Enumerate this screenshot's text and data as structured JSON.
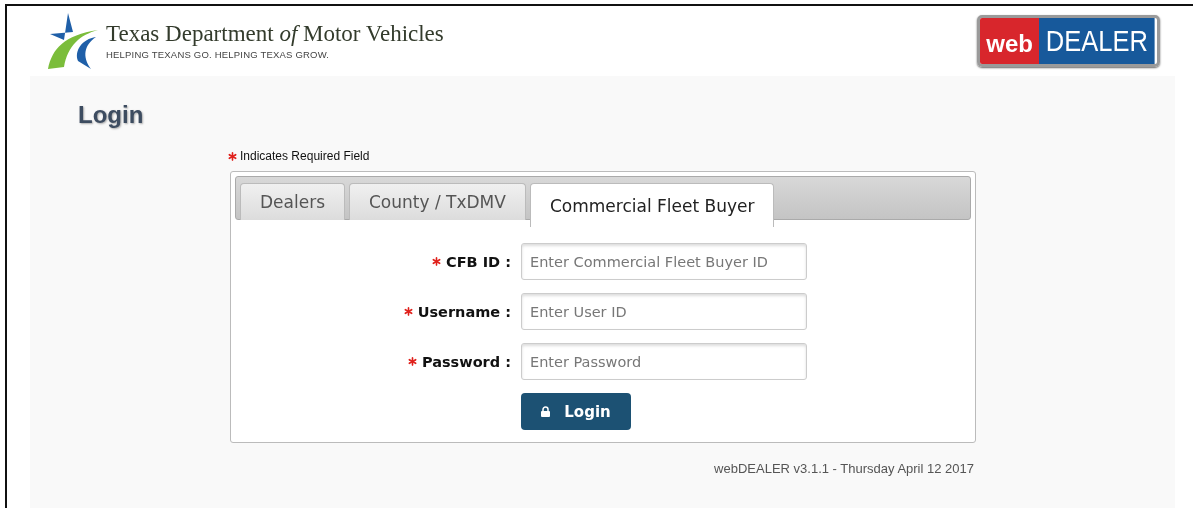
{
  "header": {
    "agency": "Texas Department *of* Motor Vehicles",
    "tagline": "HELPING TEXANS GO. HELPING TEXAS GROW.",
    "product_logo": {
      "part_1": "web",
      "part_2": "DEALER"
    }
  },
  "page_title": "Login",
  "required_note": "Indicates Required Field",
  "tabs": [
    {
      "label": "Dealers",
      "selected": false
    },
    {
      "label": "County / TxDMV",
      "selected": false
    },
    {
      "label": "Commercial Fleet Buyer",
      "selected": true
    }
  ],
  "fields": [
    {
      "label": "CFB ID :",
      "placeholder": "Enter Commercial Fleet Buyer ID",
      "required": true
    },
    {
      "label": "Username :",
      "placeholder": "Enter User ID",
      "required": true
    },
    {
      "label": "Password :",
      "placeholder": "Enter Password",
      "required": true
    }
  ],
  "login_button": "Login",
  "footer": "webDEALER v3.1.1 - Thursday April 12 2017"
}
